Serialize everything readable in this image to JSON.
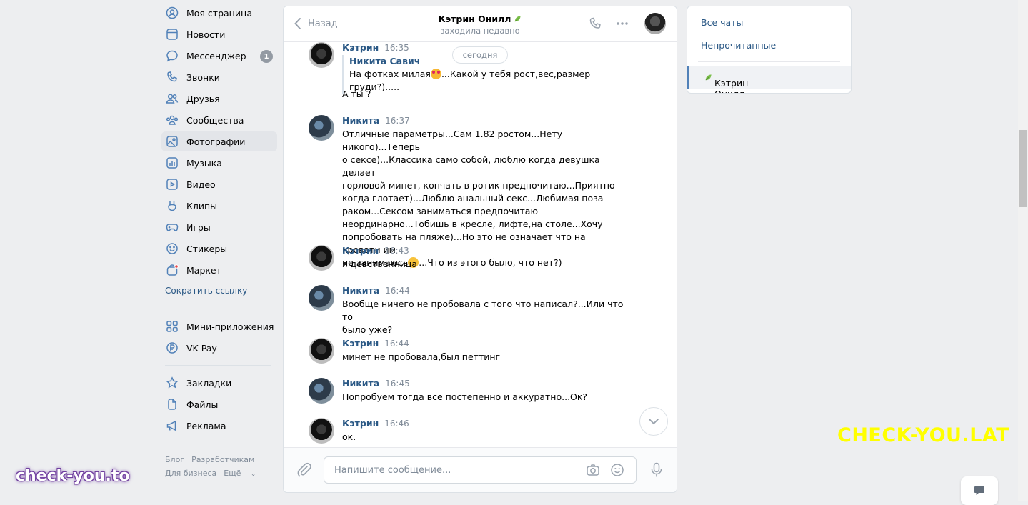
{
  "nav": {
    "items": [
      {
        "label": "Моя страница",
        "icon": "user-circle-icon"
      },
      {
        "label": "Новости",
        "icon": "news-icon"
      },
      {
        "label": "Мессенджер",
        "icon": "message-icon",
        "badge": "1"
      },
      {
        "label": "Звонки",
        "icon": "phone-icon"
      },
      {
        "label": "Друзья",
        "icon": "friends-icon"
      },
      {
        "label": "Сообщества",
        "icon": "communities-icon"
      },
      {
        "label": "Фотографии",
        "icon": "photo-icon",
        "active": true
      },
      {
        "label": "Музыка",
        "icon": "music-icon"
      },
      {
        "label": "Видео",
        "icon": "video-icon"
      },
      {
        "label": "Клипы",
        "icon": "clips-icon"
      },
      {
        "label": "Игры",
        "icon": "gamepad-icon"
      },
      {
        "label": "Стикеры",
        "icon": "smile-icon"
      },
      {
        "label": "Маркет",
        "icon": "market-icon"
      }
    ],
    "shorten_link": "Сократить ссылку",
    "items2": [
      {
        "label": "Мини-приложения",
        "icon": "apps-icon"
      },
      {
        "label": "VK Pay",
        "icon": "ruble-icon"
      }
    ],
    "items3": [
      {
        "label": "Закладки",
        "icon": "star-icon"
      },
      {
        "label": "Файлы",
        "icon": "file-icon"
      },
      {
        "label": "Реклама",
        "icon": "megaphone-icon"
      }
    ],
    "footer": {
      "blog": "Блог",
      "developers": "Разработчикам",
      "business": "Для бизнеса",
      "more": "Ещё"
    }
  },
  "chat": {
    "back_label": "Назад",
    "peer_name": "Кэтрин Онилл",
    "peer_status": "заходила недавно",
    "date_pill": "сегодня",
    "input_placeholder": "Напишите сообщение...",
    "messages": [
      {
        "author": "Кэтрин",
        "time": "16:35",
        "forwarded": {
          "author": "Никита Савич",
          "text_before": "На фотках милая",
          "text_after": "...Какой у тебя рост,вес,размер груди?)....."
        },
        "text": "А ты ?"
      },
      {
        "author": "Никита",
        "time": "16:37",
        "lines": [
          "Отличные параметры...Сам 1.82 ростом...Нету никого)...Теперь",
          "о сексе)...Классика само собой, люблю когда девушка делает",
          "горловой минет, кончать в ротик предпочитаю...Приятно",
          "когда глотает)...Люблю анальный секс...Любимая поза",
          "раком...Сексом заниматься предпочитаю",
          "неординарно...Тобишь в кресле, лифте,на столе...Хочу",
          "попробовать на пляже)...Но это не означает что на кровати им"
        ],
        "last_before": "не занимаюсь",
        "last_after": "...Что из этого было, что нет?)"
      },
      {
        "author": "Кэтрин",
        "time": "16:43",
        "text": "я девственница"
      },
      {
        "author": "Никита",
        "time": "16:44",
        "lines": [
          "Вообще ничего не пробовала с того что написал?...Или что то",
          "было уже?"
        ]
      },
      {
        "author": "Кэтрин",
        "time": "16:44",
        "text": "минет не пробовала,был петтинг"
      },
      {
        "author": "Никита",
        "time": "16:45",
        "text": "Попробуем тогда все постепенно и аккуратно...Ок?"
      },
      {
        "author": "Кэтрин",
        "time": "16:46",
        "text": "ок."
      }
    ]
  },
  "right_panel": {
    "all_chats": "Все чаты",
    "unread": "Непрочитанные",
    "active_chat": "Кэтрин Онилл"
  },
  "watermarks": {
    "yellow": "CHECK-YOU.LAT",
    "purple": "check-you.to"
  },
  "colors": {
    "link": "#2a5885",
    "muted": "#818c99",
    "background": "#edeef0",
    "watermark_yellow": "#ffff00"
  }
}
